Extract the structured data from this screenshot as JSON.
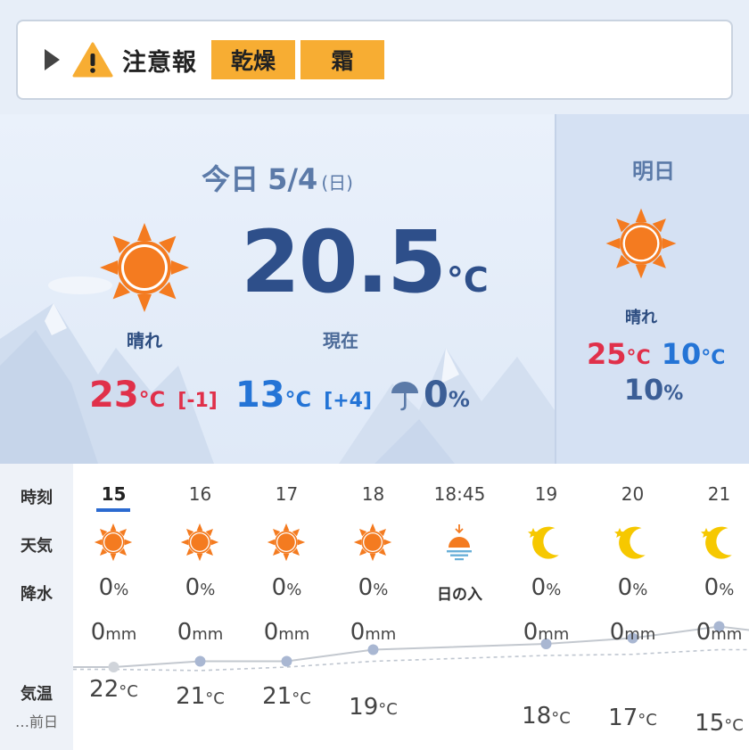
{
  "alert": {
    "label": "注意報",
    "badges": [
      "乾燥",
      "霜"
    ],
    "icon": "warning-icon",
    "color": "#f7ad33"
  },
  "today": {
    "label": "今日",
    "date": "5/4",
    "weekday": "(日)",
    "condition": "晴れ",
    "current_temp": "20.5",
    "temp_unit": "°C",
    "current_label": "現在",
    "high": "23",
    "high_diff": "[-1]",
    "low": "13",
    "low_diff": "[+4]",
    "rain": "0",
    "rain_unit": "%"
  },
  "tomorrow": {
    "label": "明日",
    "condition": "晴れ",
    "high": "25",
    "low": "10",
    "rain": "10",
    "rain_unit": "%"
  },
  "hourly": {
    "row_labels": {
      "time": "時刻",
      "weather": "天気",
      "rain": "降水",
      "temp": "気温",
      "prev": "…前日"
    },
    "hours": [
      {
        "time": "15",
        "icon": "sun-icon",
        "rain": "0",
        "mm": "0",
        "temp": "22"
      },
      {
        "time": "16",
        "icon": "sun-icon",
        "rain": "0",
        "mm": "0",
        "temp": "21"
      },
      {
        "time": "17",
        "icon": "sun-icon",
        "rain": "0",
        "mm": "0",
        "temp": "21"
      },
      {
        "time": "18",
        "icon": "sun-icon",
        "rain": "0",
        "mm": "0",
        "temp": "19"
      },
      {
        "time": "18:45",
        "icon": "sunset-icon",
        "rain_text": "日の入"
      },
      {
        "time": "19",
        "icon": "moon-icon",
        "rain": "0",
        "mm": "0",
        "temp": "18"
      },
      {
        "time": "20",
        "icon": "moon-icon",
        "rain": "0",
        "mm": "0",
        "temp": "17"
      },
      {
        "time": "21",
        "icon": "moon-icon",
        "rain": "0",
        "mm": "0",
        "temp": "15"
      }
    ],
    "units": {
      "rain": "%",
      "mm": "mm",
      "temp": "°C"
    },
    "prev_day_temps": [
      22.4,
      22.6,
      22.0,
      21.0,
      20.5,
      20.0,
      19.8,
      19.0
    ]
  },
  "colors": {
    "accent": "#2b6ad0",
    "high": "#e0304a",
    "low": "#2474d6",
    "sun": "#f47b20",
    "moon": "#f6c800"
  }
}
